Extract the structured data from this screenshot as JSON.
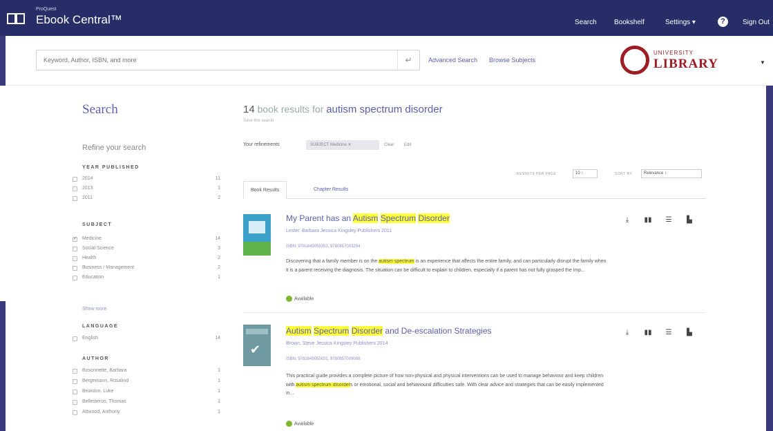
{
  "header": {
    "brand_small": "ProQuest",
    "brand": "Ebook Central™",
    "nav": [
      {
        "label": "Search"
      },
      {
        "label": "Bookshelf"
      },
      {
        "label": "Settings ▾"
      },
      {
        "label": "Sign Out"
      }
    ],
    "help_glyph": "?"
  },
  "search": {
    "placeholder": "Keyword, Author, ISBN, and more",
    "enter_glyph": "↵",
    "advanced_label": "Advanced Search",
    "browse_label": "Browse Subjects"
  },
  "library_logo": {
    "top": "UNIVERSITY",
    "name": "LIBRARY",
    "color": "#9c1e24"
  },
  "sidebar": {
    "title": "Search",
    "refine_label": "Refine your search",
    "facets": [
      {
        "heading": "YEAR PUBLISHED",
        "items": [
          {
            "label": "2014",
            "count": "11",
            "checked": false
          },
          {
            "label": "2013",
            "count": "1",
            "checked": false
          },
          {
            "label": "2011",
            "count": "2",
            "checked": false
          }
        ]
      },
      {
        "heading": "SUBJECT",
        "items": [
          {
            "label": "Medicine",
            "count": "14",
            "checked": true
          },
          {
            "label": "Social Science",
            "count": "3",
            "checked": false
          },
          {
            "label": "Health",
            "count": "2",
            "checked": false
          },
          {
            "label": "Business / Management",
            "count": "2",
            "checked": false
          },
          {
            "label": "Education",
            "count": "1",
            "checked": false
          }
        ]
      },
      {
        "heading": "LANGUAGE",
        "items": [
          {
            "label": "English",
            "count": "14",
            "checked": false
          }
        ]
      },
      {
        "heading": "AUTHOR",
        "items": [
          {
            "label": "Bosonnette, Barbara",
            "count": "1",
            "checked": false
          },
          {
            "label": "Bergemann, Rosalind",
            "count": "1",
            "checked": false
          },
          {
            "label": "Beardon, Luke",
            "count": "1",
            "checked": false
          },
          {
            "label": "Bellesteros, Thomas",
            "count": "1",
            "checked": false
          },
          {
            "label": "Attwood, Anthony",
            "count": "1",
            "checked": false
          }
        ]
      }
    ],
    "show_more": "Show more"
  },
  "results_header": {
    "count": "14",
    "mid_text": " book results for ",
    "query": "autism spectrum disorder",
    "save_search": "Save this search",
    "refinements_label": "Your refinements",
    "chip": "SUBJECT Medicine  ✕",
    "clear": "Clear",
    "edit": "Edit",
    "rpp_label": "RESULTS PER PAGE",
    "rpp_value": "10  ↕",
    "sort_label": "SORT BY",
    "sort_value": "Relevance          ↕"
  },
  "tabs": [
    {
      "label": "Book Results",
      "active": true
    },
    {
      "label": "Chapter Results",
      "active": false
    }
  ],
  "results": [
    {
      "title_parts": [
        {
          "t": "My Parent has an ",
          "hl": false
        },
        {
          "t": "Autism",
          "hl": true
        },
        {
          "t": " ",
          "hl": false
        },
        {
          "t": "Spectrum",
          "hl": true
        },
        {
          "t": " ",
          "hl": false
        },
        {
          "t": "Disorder",
          "hl": true
        }
      ],
      "meta": "Lester, Barbara  Jessica Kingsley Publishers  2011",
      "isbn": "ISBN: 9781849058353, 9780857003294",
      "desc_parts": [
        {
          "t": "Discovering that a family member is on the ",
          "hl": false
        },
        {
          "t": "autism spectrum",
          "hl": true
        },
        {
          "t": " is an experience that affects the entire family, and can particularly disrupt the family when it is a parent receiving the diagnosis. The situation can be difficult to explain to children, especially if a parent has not fully grasped the imp...",
          "hl": false
        }
      ],
      "availability": "Available"
    },
    {
      "title_parts": [
        {
          "t": "Autism",
          "hl": true
        },
        {
          "t": " ",
          "hl": false
        },
        {
          "t": "Spectrum",
          "hl": true
        },
        {
          "t": " ",
          "hl": false
        },
        {
          "t": "Disorder",
          "hl": true
        },
        {
          "t": " and De-escalation Strategies",
          "hl": false
        }
      ],
      "meta": "Brown, Steve  Jessica Kingsley Publishers  2014",
      "isbn": "ISBN: 9781849055031, 9780857009098",
      "desc_parts": [
        {
          "t": "This practical guide provides a complete picture of how non-physical and physical interventions can be used to manage behaviour and keep children with ",
          "hl": false
        },
        {
          "t": "autism spectrum disorder",
          "hl": true
        },
        {
          "t": "s or emotional, social and behavioural difficulties safe. With clear advice and strategies that can be easily implemented in...",
          "hl": false
        }
      ],
      "availability": "Available"
    }
  ],
  "action_icons": [
    "download-icon",
    "read-online-icon",
    "table-of-contents-icon",
    "add-to-bookshelf-icon"
  ],
  "colors": {
    "navy": "#262d67",
    "link": "#5a5fae",
    "highlight": "#ffff3a",
    "available": "#7db82e"
  }
}
